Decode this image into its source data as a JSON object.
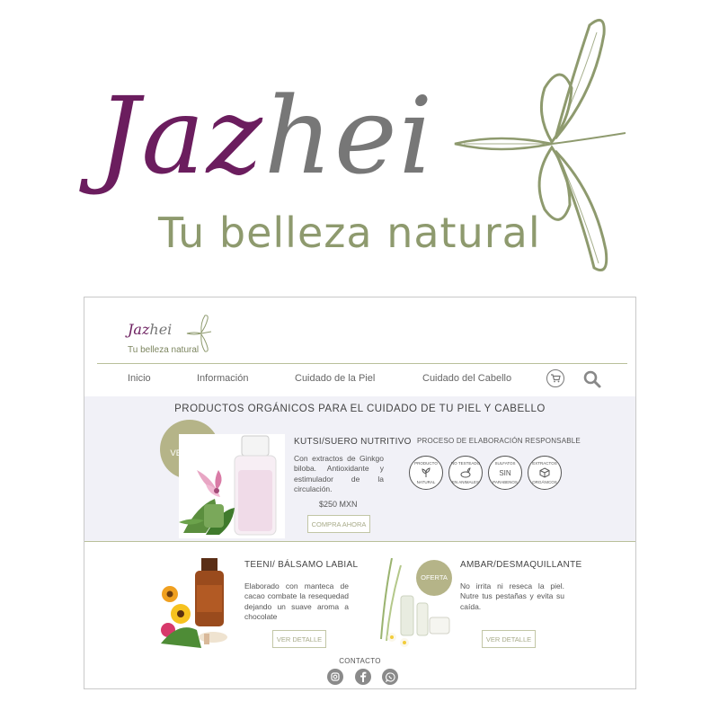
{
  "brand": {
    "name_part1": "Jaz",
    "name_part2": "hei",
    "tagline": "Tu belleza natural"
  },
  "nav": {
    "items": [
      "Inicio",
      "Información",
      "Cuidado de la Piel",
      "Cuidado del Cabello"
    ]
  },
  "icons": {
    "cart": "shopping-cart-icon",
    "search": "search-icon",
    "social": [
      "instagram-icon",
      "facebook-icon",
      "whatsapp-icon"
    ]
  },
  "main_heading": "PRODUCTOS ORGÁNICOS PARA EL CUIDADO DE TU PIEL Y CABELLO",
  "featured": {
    "badge": "MÁS VENDIDO",
    "title": "KUTSI/SUERO NUTRITIVO",
    "description": "Con extractos de Ginkgo biloba. Antioxidante y estimulador de la circulación.",
    "price": "$250 MXN",
    "button": "COMPRA AHORA"
  },
  "process": {
    "title": "PROCESO DE ELABORACIÓN RESPONSABLE",
    "seals": [
      {
        "top": "PRODUCTO",
        "bottom": "NATURAL"
      },
      {
        "top": "NO TESTEADO",
        "bottom": "EN ANIMALES"
      },
      {
        "top": "SULFATOS",
        "mid": "SIN",
        "bottom": "PARABENOS"
      },
      {
        "top": "EXTRACTOS",
        "bottom": "ORGÁNICOS"
      }
    ]
  },
  "products": [
    {
      "title": "TEENI/ BÁLSAMO LABIAL",
      "description": "Elaborado con manteca de cacao combate la resequedad dejando un suave aroma a chocolate",
      "button": "VER DETALLE"
    },
    {
      "badge": "OFERTA",
      "title": "AMBAR/DESMAQUILLANTE",
      "description": "No irrita ni reseca la piel. Nutre tus pestañas y evita su caída.",
      "button": "VER DETALLE"
    }
  ],
  "footer": {
    "contact": "CONTACTO"
  },
  "colors": {
    "brand_purple": "#6b1d5e",
    "brand_gray": "#777777",
    "olive": "#8e9a6e",
    "badge": "#b5b488",
    "featured_bg": "#f1f1f7"
  }
}
